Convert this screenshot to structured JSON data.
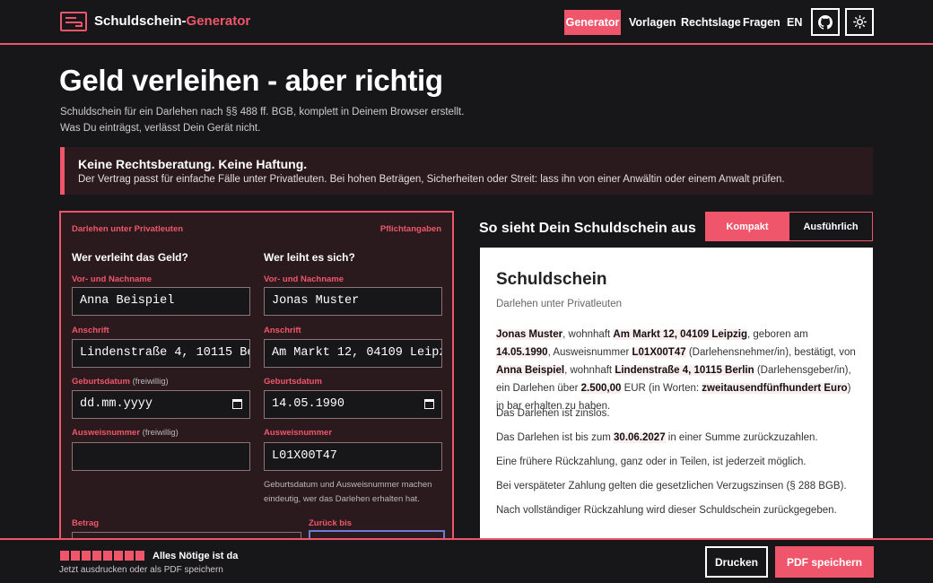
{
  "header": {
    "brand_main": "Schuldschein-",
    "brand_accent": "Generator",
    "nav": [
      "Generator",
      "Vorlagen",
      "Rechtslage",
      "Fragen",
      "EN"
    ],
    "icons": [
      "github-icon",
      "sun-icon"
    ]
  },
  "hero": {
    "title": "Geld verleihen - aber richtig",
    "sub1": "Schuldschein für ein Darlehen nach §§ 488 ff. BGB, komplett in Deinem Browser erstellt.",
    "sub2": "Was Du einträgst, verlässt Dein Gerät nicht."
  },
  "warning": {
    "title": "Keine Rechtsberatung. Keine Haftung.",
    "body": "Der Vertrag passt für einfache Fälle unter Privatleuten. Bei hohen Beträgen, Sicherheiten oder Streit: lass ihn von einer Anwältin oder einem Anwalt prüfen."
  },
  "form": {
    "section_label": "Darlehen unter Privatleuten",
    "required_label": "Pflichtangaben",
    "lender": {
      "heading": "Wer verleiht das Geld?",
      "name_label": "Vor- und Nachname",
      "name_value": "Anna Beispiel",
      "address_label": "Anschrift",
      "address_value": "Lindenstraße 4, 10115 Berlin",
      "birth_label": "Geburtsdatum",
      "birth_opt": "(freiwillig)",
      "birth_value": "dd.mm.yyyy",
      "id_label": "Ausweisnummer",
      "id_opt": "(freiwillig)",
      "id_value": ""
    },
    "borrower": {
      "heading": "Wer leiht es sich?",
      "name_label": "Vor- und Nachname",
      "name_value": "Jonas Muster",
      "address_label": "Anschrift",
      "address_value": "Am Markt 12, 04109 Leipzig",
      "birth_label": "Geburtsdatum",
      "birth_value": "14.05.1990",
      "id_label": "Ausweisnummer",
      "id_value": "L01X00T47"
    },
    "hint": "Geburtsdatum und Ausweisnummer machen eindeutig, wer das Darlehen erhalten hat.",
    "amount_label": "Betrag",
    "return_label": "Zurück bis"
  },
  "preview": {
    "title": "So sieht Dein Schuldschein aus",
    "tab_compact": "Kompakt",
    "tab_detailed": "Ausführlich",
    "doc_title": "Schuldschein",
    "doc_sub": "Darlehen unter Privatleuten",
    "p1": {
      "borrower": "Jonas Muster",
      "t1": ", wohnhaft ",
      "baddr": "Am Markt 12, 04109 Leipzig",
      "t2": ", geboren am ",
      "bdate": "14.05.1990",
      "t3": ", Ausweisnummer ",
      "bid": "L01X00T47",
      "t4": " (Darlehensnehmer/in), bestätigt, von ",
      "lender": "Anna Beispiel",
      "t5": ", wohnhaft ",
      "laddr": "Lindenstraße 4, 10115 Berlin",
      "t6": " (Darlehensgeber/in), ein Darlehen über ",
      "amount": "2.500,00",
      "t7": " EUR (in Worten: ",
      "words": "zweitausendfünfhundert Euro",
      "t8": ") in bar erhalten zu haben."
    },
    "p2": "Das Darlehen ist zinslos.",
    "p3a": "Das Darlehen ist bis zum ",
    "p3date": "30.06.2027",
    "p3b": " in einer Summe zurückzuzahlen.",
    "p4": "Eine frühere Rückzahlung, ganz oder in Teilen, ist jederzeit möglich.",
    "p5": "Bei verspäteter Zahlung gelten die gesetzlichen Verzugszinsen (§ 288 BGB).",
    "p6": "Nach vollständiger Rückzahlung wird dieser Schuldschein zurückgegeben."
  },
  "footer": {
    "status": "Alles Nötige ist da",
    "sub": "Jetzt ausdrucken oder als PDF speichern",
    "print": "Drucken",
    "pdf": "PDF speichern",
    "progress": {
      "filled": 8,
      "total": 8
    }
  },
  "colors": {
    "accent": "#f0566b",
    "bg": "#17171a",
    "form_bg": "#2a1a1d"
  }
}
